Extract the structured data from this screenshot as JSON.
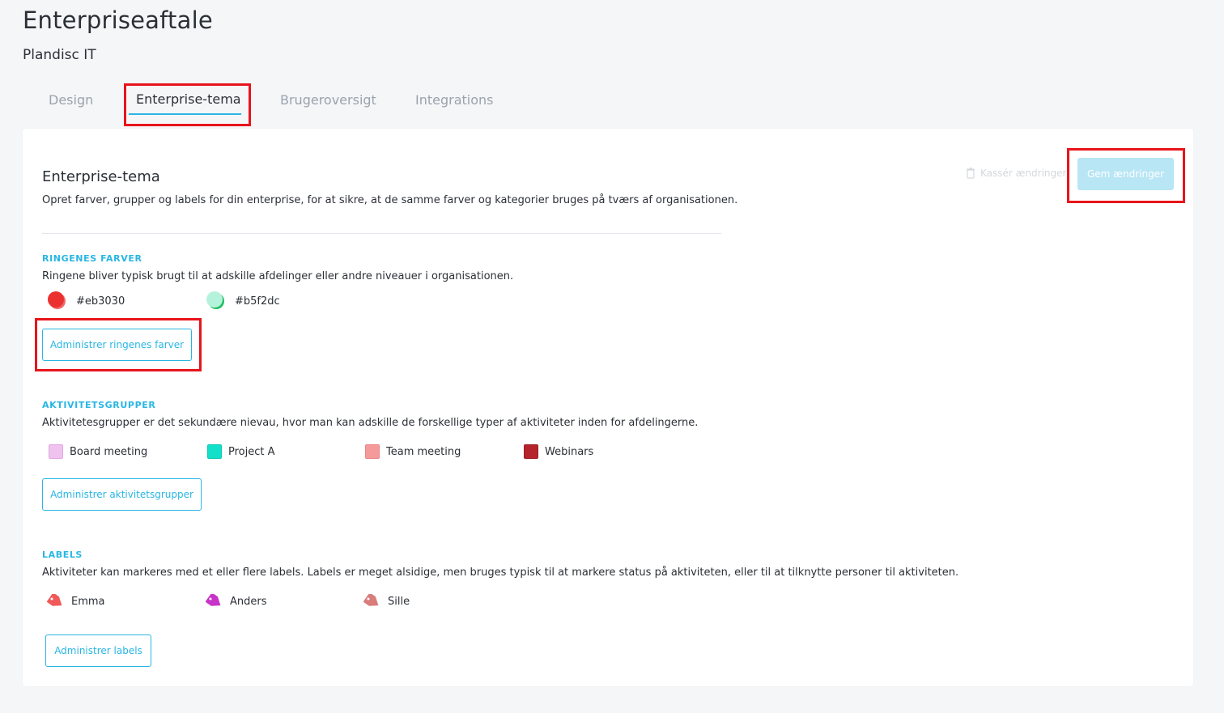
{
  "page": {
    "title": "Enterpriseaftale",
    "subtitle": "Plandisc IT"
  },
  "tabs": [
    {
      "label": "Design",
      "active": false
    },
    {
      "label": "Enterprise-tema",
      "active": true
    },
    {
      "label": "Brugeroversigt",
      "active": false
    },
    {
      "label": "Integrations",
      "active": false
    }
  ],
  "actions": {
    "discard_label": "Kassér ændringer",
    "save_label": "Gem ændringer"
  },
  "theme": {
    "heading": "Enterprise-tema",
    "description": "Opret farver, grupper og labels for din enterprise, for at sikre, at de samme farver og kategorier bruges på tværs af organisationen."
  },
  "rings": {
    "heading": "RINGENES FARVER",
    "description": "Ringene bliver typisk brugt til at adskille afdelinger eller andre niveauer i organisationen.",
    "items": [
      {
        "label": "#eb3030",
        "color": "#eb3030",
        "shade": "#f06a6a"
      },
      {
        "label": "#b5f2dc",
        "color": "#b5f2dc",
        "shade": "#1fbf5e"
      }
    ],
    "button_label": "Administrer ringenes farver"
  },
  "groups": {
    "heading": "AKTIVITETSGRUPPER",
    "description": "Aktivitetesgrupper er det sekundære nievau, hvor man kan adskille de forskellige typer af aktiviteter inden for afdelingerne.",
    "items": [
      {
        "label": "Board meeting",
        "color": "#f0c2f0"
      },
      {
        "label": "Project A",
        "color": "#12e0c8"
      },
      {
        "label": "Team meeting",
        "color": "#f59a9a"
      },
      {
        "label": "Webinars",
        "color": "#b5242b"
      }
    ],
    "button_label": "Administrer aktivitetsgrupper"
  },
  "labels": {
    "heading": "LABELS",
    "description": "Aktiviteter kan markeres med et eller flere labels. Labels er meget alsidige, men bruges typisk til at markere status på aktiviteten, eller til at tilknytte personer til aktiviteten.",
    "items": [
      {
        "label": "Emma",
        "color": "#f05a5a"
      },
      {
        "label": "Anders",
        "color": "#c833c8"
      },
      {
        "label": "Sille",
        "color": "#d97c7c"
      }
    ],
    "button_label": "Administrer labels"
  },
  "icons": {
    "discard": "trash-icon",
    "label": "tag-icon"
  },
  "colors": {
    "accent": "#29b6e4",
    "highlight": "#e8141b",
    "save_button_bg": "#b8e6f5"
  }
}
